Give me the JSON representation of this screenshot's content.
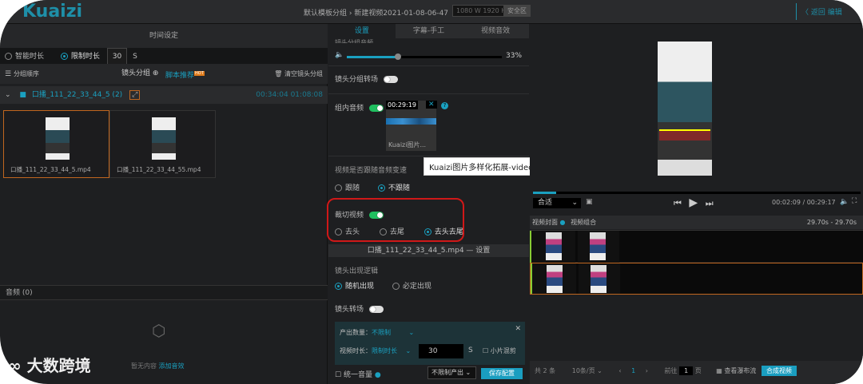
{
  "header": {
    "logo": "Kuaizi",
    "breadcrumb": "默认模板分组 › 新建视频2021-01-08-06-47",
    "dimensions": "1080 W 1920 H",
    "safe_zone": "安全区",
    "back": "〈 返回 编辑"
  },
  "left": {
    "title": "时间设定",
    "radio_smart": "智能时长",
    "radio_limit": "限制时长",
    "limit_value": "30",
    "limit_unit": "S",
    "group_order": "分组顺序",
    "shot_group": "镜头分组",
    "script_recommend": "脚本推荐",
    "hot_badge": "HOT",
    "clear_groups": "清空镜头分组",
    "group_name": "口播_111_22_33_44_5 (2)",
    "group_time": "00:34:04 01:08:08",
    "clips": [
      {
        "name": "口播_111_22_33_44_5.mp4"
      },
      {
        "name": "口播_111_22_33_44_55.mp4"
      }
    ],
    "audio_title": "音频 (0)",
    "empty_text": "暂无内容",
    "add_music": "添加音效",
    "watermark": "大数跨境"
  },
  "mid": {
    "tabs": [
      "设置",
      "字幕-手工",
      "视频音效"
    ],
    "volume_label": "镜头分组音频",
    "volume_pct": "33%",
    "volume_value": 33,
    "transition_label": "镜头分组转场",
    "group_audio_label": "组内音频",
    "audio_time": "00:29:19",
    "audio_name": "Kuaizi图片...",
    "tooltip": "Kuaizi图片多样化拓展-video demo",
    "follow_label": "视频是否跟随音频变速",
    "follow": "跟随",
    "no_follow": "不跟随",
    "trim_label": "裁切视频",
    "trim_head": "去头",
    "trim_tail": "去尾",
    "trim_both": "去头去尾",
    "clip_settings": "口播_111_22_33_44_5.mp4 — 设置",
    "appear_label": "镜头出现逻辑",
    "random": "随机出现",
    "must": "必定出现",
    "shot_transition": "镜头转场",
    "output_count_label": "产出数量：",
    "output_count": "不限制",
    "duration_label": "视频时长：",
    "duration_mode": "限制时长",
    "duration_value": "30",
    "duration_unit": "S",
    "small_only": "小片混剪",
    "unify_volume": "统一音量",
    "output_select": "不限制产出",
    "save_button": "保存配置"
  },
  "right": {
    "fit": "合适",
    "time": "00:02:09 / 00:29:17",
    "progress": 0.07,
    "cover_label": "视频封面",
    "combo_label": "视频组合",
    "range": "29.70s - 29.70s",
    "total": "共 2 条",
    "page_size": "10条/页",
    "page": "1",
    "goto": "前往",
    "goto_value": "1",
    "page_unit": "页",
    "waterfall": "查看瀑布流",
    "compose": "合成视频"
  }
}
